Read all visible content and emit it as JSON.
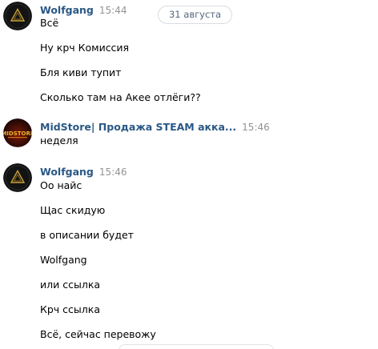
{
  "date_separator": "31 августа",
  "messages": [
    {
      "author": "Wolfgang",
      "time": "15:44",
      "avatar_icon": "dark-logo-avatar",
      "lines": [
        "Всё",
        "Ну крч Комиссия",
        "Бля киви тупит",
        "Сколько там на Акее отлёги??"
      ]
    },
    {
      "author": "MidStore| Продажа STEAM акка...",
      "time": "15:46",
      "avatar_icon": "midstore-logo-avatar",
      "avatar_text": "MIDSTORE",
      "lines": [
        "неделя"
      ]
    },
    {
      "author": "Wolfgang",
      "time": "15:46",
      "avatar_icon": "dark-logo-avatar",
      "lines": [
        "Оо найс",
        "Щас скидую",
        "в описании будет",
        "Wolfgang",
        "или ссылка",
        "Крч ссылка",
        "Всё, сейчас перевожу"
      ]
    }
  ],
  "colors": {
    "author": "#2a5885",
    "time": "#939393",
    "text": "#000000",
    "date_pill_text": "#55677d",
    "date_pill_border": "#d7dce2"
  }
}
